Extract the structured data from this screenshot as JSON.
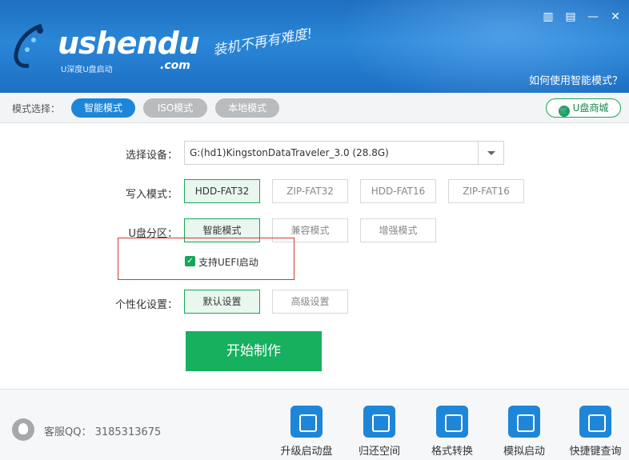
{
  "header": {
    "logo_text": "ushendu",
    "logo_sub": "U深度U盘启动",
    "logo_com": ".com",
    "slogan": "装机不再有难度!",
    "help_link": "如何使用智能模式？"
  },
  "modebar": {
    "label": "模式选择：",
    "tabs": [
      {
        "label": "智能模式",
        "active": true
      },
      {
        "label": "ISO模式",
        "active": false
      },
      {
        "label": "本地模式",
        "active": false
      }
    ],
    "shop_label": "U盘商城"
  },
  "form": {
    "device_label": "选择设备：",
    "device_value": "G:(hd1)KingstonDataTraveler_3.0 (28.8G)",
    "write_label": "写入模式：",
    "write_options": [
      "HDD-FAT32",
      "ZIP-FAT32",
      "HDD-FAT16",
      "ZIP-FAT16"
    ],
    "write_selected": "HDD-FAT32",
    "partition_label": "U盘分区：",
    "partition_options": [
      "智能模式",
      "兼容模式",
      "增强模式"
    ],
    "partition_selected": "智能模式",
    "uefi_label": "支持UEFI启动",
    "uefi_checked": true,
    "personal_label": "个性化设置：",
    "personal_options": [
      "默认设置",
      "高级设置"
    ],
    "personal_selected": "默认设置",
    "start_label": "开始制作"
  },
  "footer": {
    "qq_text": "客服QQ： 3185313675",
    "tools": [
      "升级启动盘",
      "归还空间",
      "格式转换",
      "模拟启动",
      "快捷键查询"
    ]
  },
  "colors": {
    "brand_blue": "#1e86d8",
    "accent_green": "#17b05f",
    "highlight_red": "#d93636"
  }
}
